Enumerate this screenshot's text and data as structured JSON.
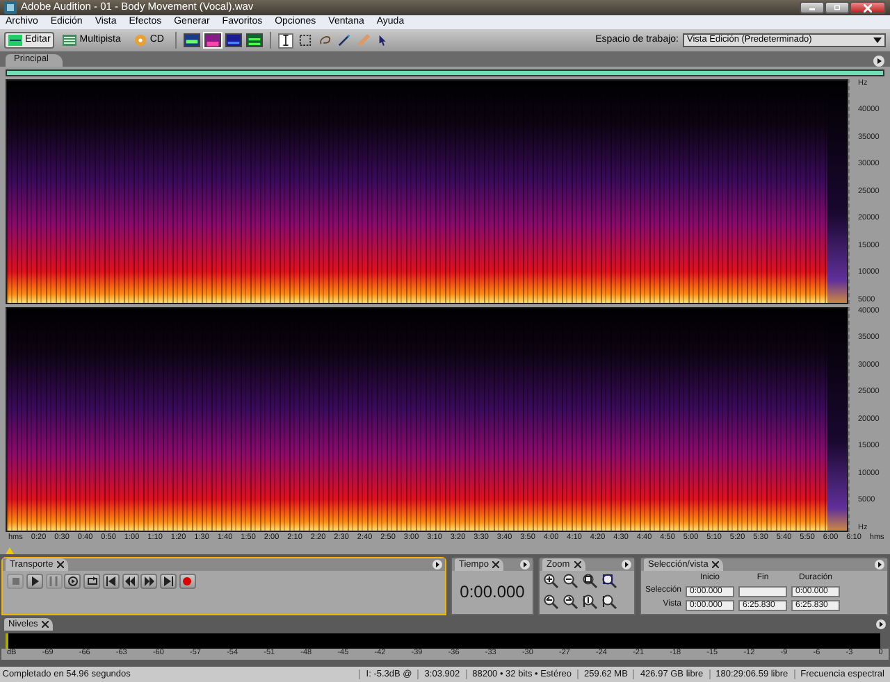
{
  "window": {
    "title": "Adobe Audition - 01 - Body Movement (Vocal).wav"
  },
  "menu": [
    "Archivo",
    "Edición",
    "Vista",
    "Efectos",
    "Generar",
    "Favoritos",
    "Opciones",
    "Ventana",
    "Ayuda"
  ],
  "toolbar": {
    "modes": [
      {
        "kind": "edit",
        "label": "Editar",
        "selected": true
      },
      {
        "kind": "multitrack",
        "label": "Multipista",
        "selected": false
      },
      {
        "kind": "cd",
        "label": "CD",
        "selected": false
      }
    ],
    "views": [
      {
        "kind": "waveform",
        "selected": false
      },
      {
        "kind": "spectral",
        "selected": true
      },
      {
        "kind": "pan",
        "selected": false
      },
      {
        "kind": "phase",
        "selected": false
      }
    ],
    "tools": [
      {
        "kind": "ibeam",
        "selected": true
      },
      {
        "kind": "marquee",
        "selected": false
      },
      {
        "kind": "lasso",
        "selected": false
      },
      {
        "kind": "brush",
        "selected": false
      },
      {
        "kind": "heal",
        "selected": false
      },
      {
        "kind": "hand",
        "selected": false
      }
    ],
    "workspace_label": "Espacio de trabajo:",
    "workspace_value": "Vista Edición (Predeterminado)"
  },
  "main_tab": "Principal",
  "spectrogram": {
    "channels": [
      {
        "hz_labels": [
          "Hz",
          "40000",
          "35000",
          "30000",
          "25000",
          "20000",
          "15000",
          "10000",
          "5000"
        ]
      },
      {
        "hz_labels": [
          "40000",
          "35000",
          "30000",
          "25000",
          "20000",
          "15000",
          "10000",
          "5000",
          "Hz"
        ]
      }
    ],
    "time_labels": [
      "hms",
      "0:20",
      "0:30",
      "0:40",
      "0:50",
      "1:00",
      "1:10",
      "1:20",
      "1:30",
      "1:40",
      "1:50",
      "2:00",
      "2:10",
      "2:20",
      "2:30",
      "2:40",
      "2:50",
      "3:00",
      "3:10",
      "3:20",
      "3:30",
      "3:40",
      "3:50",
      "4:00",
      "4:10",
      "4:20",
      "4:30",
      "4:40",
      "4:50",
      "5:00",
      "5:10",
      "5:20",
      "5:30",
      "5:40",
      "5:50",
      "6:00",
      "6:10",
      "hms"
    ]
  },
  "transport": {
    "title": "Transporte",
    "buttons": [
      {
        "kind": "stop",
        "disabled": true
      },
      {
        "kind": "play",
        "disabled": false
      },
      {
        "kind": "pause",
        "disabled": true
      },
      {
        "kind": "play-from",
        "disabled": false
      },
      {
        "kind": "loop",
        "disabled": false
      },
      {
        "kind": "to-start",
        "disabled": false
      },
      {
        "kind": "rewind",
        "disabled": false
      },
      {
        "kind": "forward",
        "disabled": false
      },
      {
        "kind": "to-end",
        "disabled": false
      },
      {
        "kind": "record",
        "disabled": false
      }
    ]
  },
  "time": {
    "title": "Tiempo",
    "value": "0:00.000"
  },
  "zoom": {
    "title": "Zoom",
    "buttons": [
      {
        "kind": "in"
      },
      {
        "kind": "out"
      },
      {
        "kind": "full"
      },
      {
        "kind": "sel"
      },
      {
        "kind": "left"
      },
      {
        "kind": "right"
      },
      {
        "kind": "vin"
      },
      {
        "kind": "vout"
      }
    ]
  },
  "selection": {
    "title": "Selección/vista",
    "columns": [
      "Inicio",
      "Fin",
      "Duración"
    ],
    "rows": [
      {
        "label": "Selección",
        "start": "0:00.000",
        "duration": "0:00.000"
      },
      {
        "label": "Vista",
        "start": "0:00.000",
        "end": "6:25.830",
        "duration": "6:25.830"
      }
    ]
  },
  "levels": {
    "title": "Niveles",
    "scale": [
      "dB",
      "-69",
      "-66",
      "-63",
      "-60",
      "-57",
      "-54",
      "-51",
      "-48",
      "-45",
      "-42",
      "-39",
      "-36",
      "-33",
      "-30",
      "-27",
      "-24",
      "-21",
      "-18",
      "-15",
      "-12",
      "-9",
      "-6",
      "-3",
      "0"
    ]
  },
  "status_bar": [
    {
      "kind": "message",
      "text": "Completado en 54.96 segundos"
    },
    {
      "kind": "cell",
      "text": "I: -5.3dB @"
    },
    {
      "kind": "cell",
      "text": "3:03.902"
    },
    {
      "kind": "cell",
      "text": "88200 • 32 bits • Estéreo"
    },
    {
      "kind": "cell",
      "text": "259.62 MB"
    },
    {
      "kind": "cell",
      "text": "426.97 GB libre"
    },
    {
      "kind": "cell",
      "text": "180:29:06.59 libre"
    },
    {
      "kind": "cell",
      "text": "Frecuencia espectral"
    }
  ]
}
